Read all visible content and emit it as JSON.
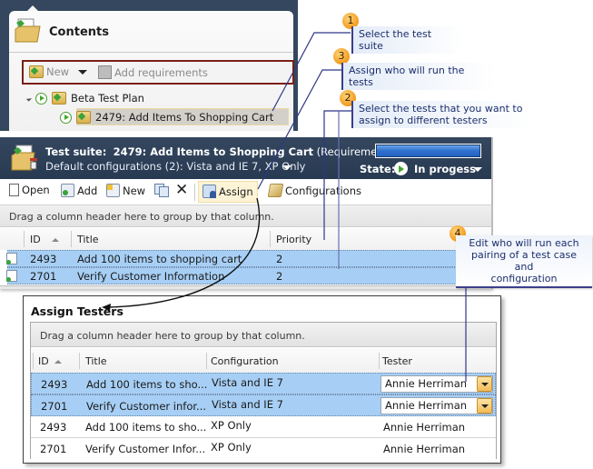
{
  "contents_panel": {
    "title": "Contents",
    "toolbar": {
      "new_label": "New",
      "add_requirements_label": "Add requirements"
    },
    "tree": [
      {
        "label": "Beta Test Plan",
        "level": 0,
        "expanded": true
      },
      {
        "label": "2479: Add Items To Shopping Cart",
        "level": 1,
        "selected": true
      }
    ]
  },
  "suite_panel": {
    "title_prefix": "Test suite:",
    "title_name": "2479: Add Items to Shopping Cart",
    "title_suffix": "(Requirement 2470)",
    "subtitle": "Default configurations (2): Vista and IE 7, XP Only",
    "progress_fraction": 1.0,
    "state_label": "State:",
    "state_value": "In progess",
    "toolbar": {
      "open": "Open",
      "add": "Add",
      "new": "New",
      "assign": "Assign",
      "configurations": "Configurations"
    },
    "group_hint": "Drag a column header here to group by that column.",
    "columns": [
      "ID",
      "Title",
      "Priority"
    ],
    "rows": [
      {
        "id": "2493",
        "title": "Add 100 items to shopping cart",
        "priority": "2"
      },
      {
        "id": "2701",
        "title": "Verify Customer Information",
        "priority": "2"
      }
    ]
  },
  "assign_dialog": {
    "title": "Assign Testers",
    "group_hint": "Drag a column header here to group by that column.",
    "columns": [
      "ID",
      "Title",
      "Configuration",
      "Tester"
    ],
    "rows": [
      {
        "id": "2493",
        "title": "Add 100 items to sho...",
        "configuration": "Vista and IE 7",
        "tester": "Annie Herriman",
        "selected": true
      },
      {
        "id": "2701",
        "title": "Verify Customer infor...",
        "configuration": "Vista and IE 7",
        "tester": "Annie Herriman",
        "selected": true
      },
      {
        "id": "2493",
        "title": "Add 100 items to sho...",
        "configuration": "XP Only",
        "tester": "Annie Herriman",
        "selected": false
      },
      {
        "id": "2701",
        "title": "Verify Customer Infor...",
        "configuration": "XP Only",
        "tester": "Annie Herriman",
        "selected": false
      }
    ]
  },
  "callouts": [
    {
      "number": "1",
      "text": "Select the test suite"
    },
    {
      "number": "3",
      "text": "Assign who will run the tests"
    },
    {
      "number": "2",
      "text_line1": "Select the tests that you want to",
      "text_line2": "assign to different testers"
    },
    {
      "number": "4",
      "text_line1": "Edit who will run each",
      "text_line2": "pairing of a test case and",
      "text_line3": "configuration"
    }
  ],
  "colors": {
    "header_bg": "#2e4159",
    "selection": "#a7cff5",
    "callout_text": "#1b2e6b",
    "badge": "#f29a1c",
    "toolbar_highlight_border": "#7b1f14"
  }
}
